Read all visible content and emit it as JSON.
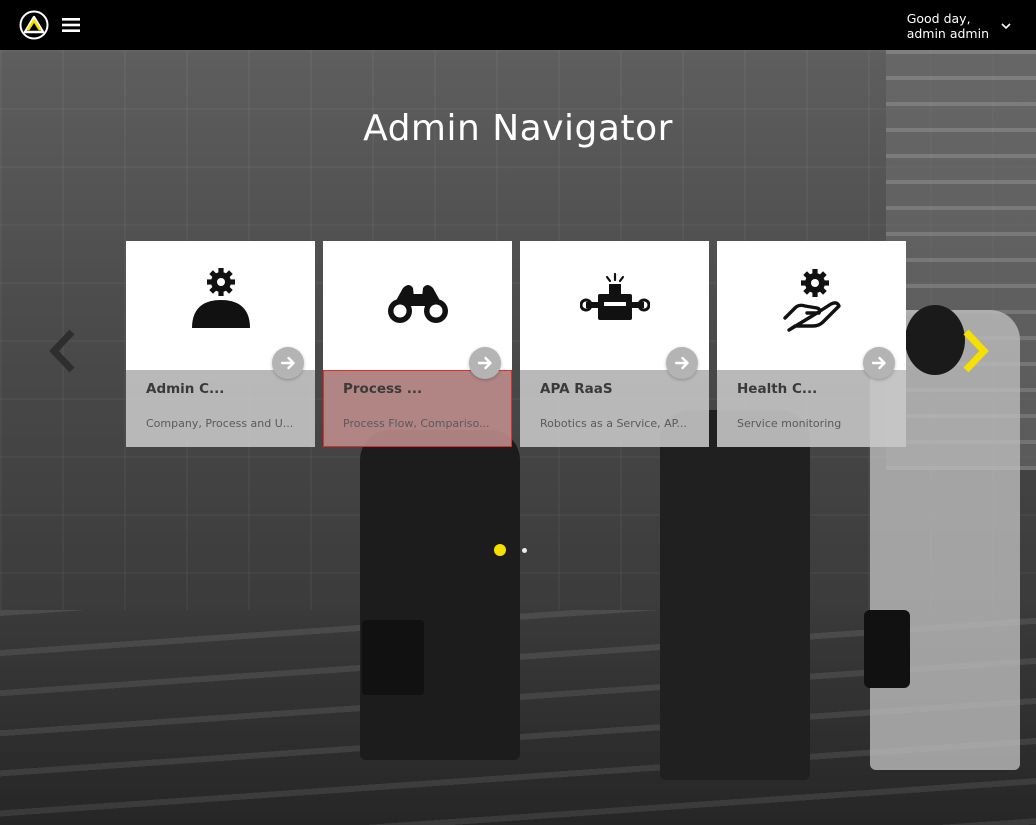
{
  "header": {
    "greeting_line1": "Good day,",
    "greeting_line2": "admin admin",
    "logo_icon": "company-logo-icon",
    "menu_icon": "hamburger-menu-icon",
    "user_menu_icon": "chevron-down-icon"
  },
  "page": {
    "title": "Admin Navigator"
  },
  "carousel": {
    "prev_icon": "chevron-left-icon",
    "next_icon": "chevron-right-icon",
    "cards": [
      {
        "title": "Admin C...",
        "description": "Company, Process and U...",
        "icon": "user-gear-icon",
        "selected": false
      },
      {
        "title": "Process ...",
        "description": "Process Flow, Compariso...",
        "icon": "binoculars-icon",
        "selected": true
      },
      {
        "title": "APA RaaS",
        "description": "Robotics as a Service, AP...",
        "icon": "robot-icon",
        "selected": false
      },
      {
        "title": "Health C...",
        "description": "Service monitoring",
        "icon": "hand-gear-icon",
        "selected": false
      }
    ],
    "pages": [
      {
        "active": true
      },
      {
        "active": false
      }
    ]
  },
  "colors": {
    "accent": "#f5e000",
    "topbar": "#000000",
    "selected_outline": "#d9302c"
  }
}
